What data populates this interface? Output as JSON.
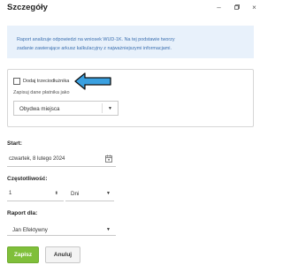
{
  "window": {
    "title": "Szczegóły",
    "controls": {
      "minimize": "–",
      "restore": "restore-icon",
      "close": "×"
    }
  },
  "info": {
    "line1": "Raport analizuje odpowiedzi na wniosek WUD-1K. Na tej podstawie tworzy",
    "line2": "zadanie zawierające arkusz kalkulacyjny z najważniejszymi informacjami."
  },
  "options": {
    "add_third_party_label": "Dodaj trzeciodłużnika",
    "add_third_party_checked": false,
    "payer_label": "Zapisuj dane płatnika jako",
    "payer_value": "Obydwa miejsca",
    "arrow_color": "#3aa0e0"
  },
  "start": {
    "label": "Start:",
    "value": "czwartek, 8 lutego 2024",
    "icon": "calendar-icon"
  },
  "frequency": {
    "label": "Częstotliwość:",
    "count": "1",
    "unit": "Dni"
  },
  "report_for": {
    "label": "Raport dla:",
    "value": "Jan Efektywny"
  },
  "buttons": {
    "save": "Zapisz",
    "cancel": "Anuluj",
    "save_color": "#7fbf3a"
  }
}
